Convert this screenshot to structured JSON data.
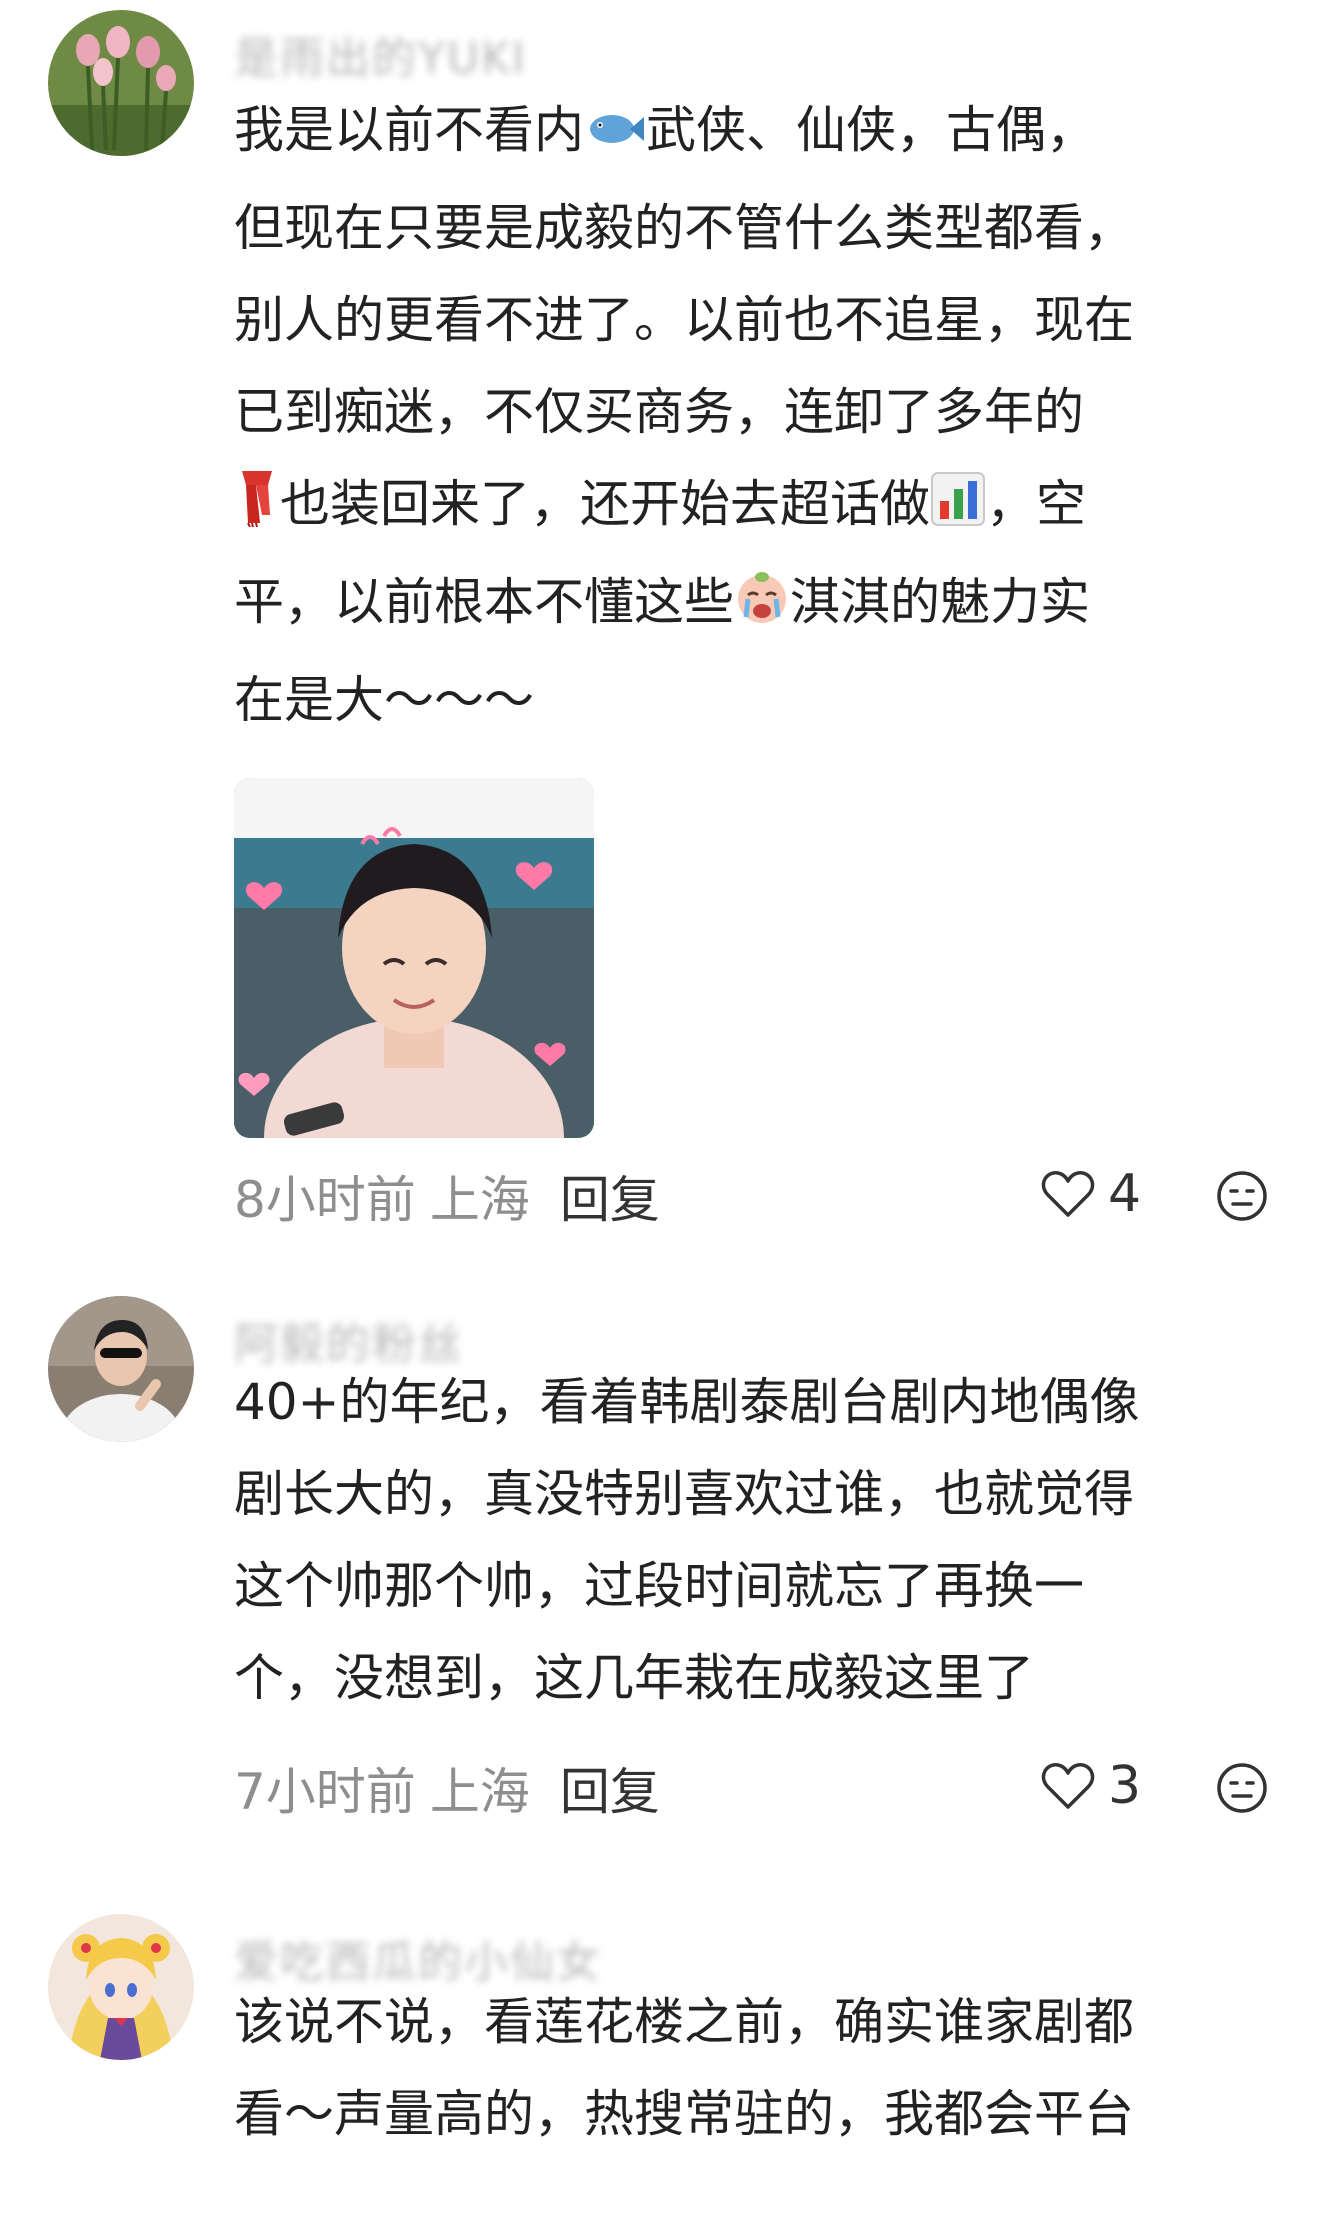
{
  "comments": [
    {
      "username": "是雨出的YUKI",
      "text_lines": [
        "我是以前不看内{fish}武侠、仙侠，古偶，",
        "但现在只要是成毅的不管什么类型都看，",
        "别人的更看不进了。以前也不追星，现在",
        "已到痴迷，不仅买商务，连卸了多年的",
        "{scarf}也装回来了，还开始去超话做{chart}，空",
        "平，以前根本不懂这些{cry}淇淇的魅力实",
        "在是大～～～"
      ],
      "time": "8小时前",
      "location": "上海",
      "reply_label": "回复",
      "likes": "4"
    },
    {
      "username": "阿毅的粉丝",
      "text_lines": [
        "40+的年纪，看着韩剧泰剧台剧内地偶像",
        "剧长大的，真没特别喜欢过谁，也就觉得",
        "这个帅那个帅，过段时间就忘了再换一",
        "个，没想到，这几年栽在成毅这里了"
      ],
      "time": "7小时前",
      "location": "上海",
      "reply_label": "回复",
      "likes": "3"
    },
    {
      "username": "爱吃西瓜的小仙女",
      "text_lines": [
        "该说不说，看莲花楼之前，确实谁家剧都",
        "看～声量高的，热搜常驻的，我都会平台"
      ]
    }
  ],
  "icons": {
    "fish": "fish-emoji-icon",
    "scarf": "red-scarf-emoji-icon",
    "chart": "bar-chart-emoji-icon",
    "cry": "crying-face-emoji-icon",
    "like": "heart-outline-icon",
    "dislike": "meh-face-icon"
  },
  "colors": {
    "text": "#222222",
    "meta": "#8e8e8e",
    "background": "#ffffff"
  }
}
